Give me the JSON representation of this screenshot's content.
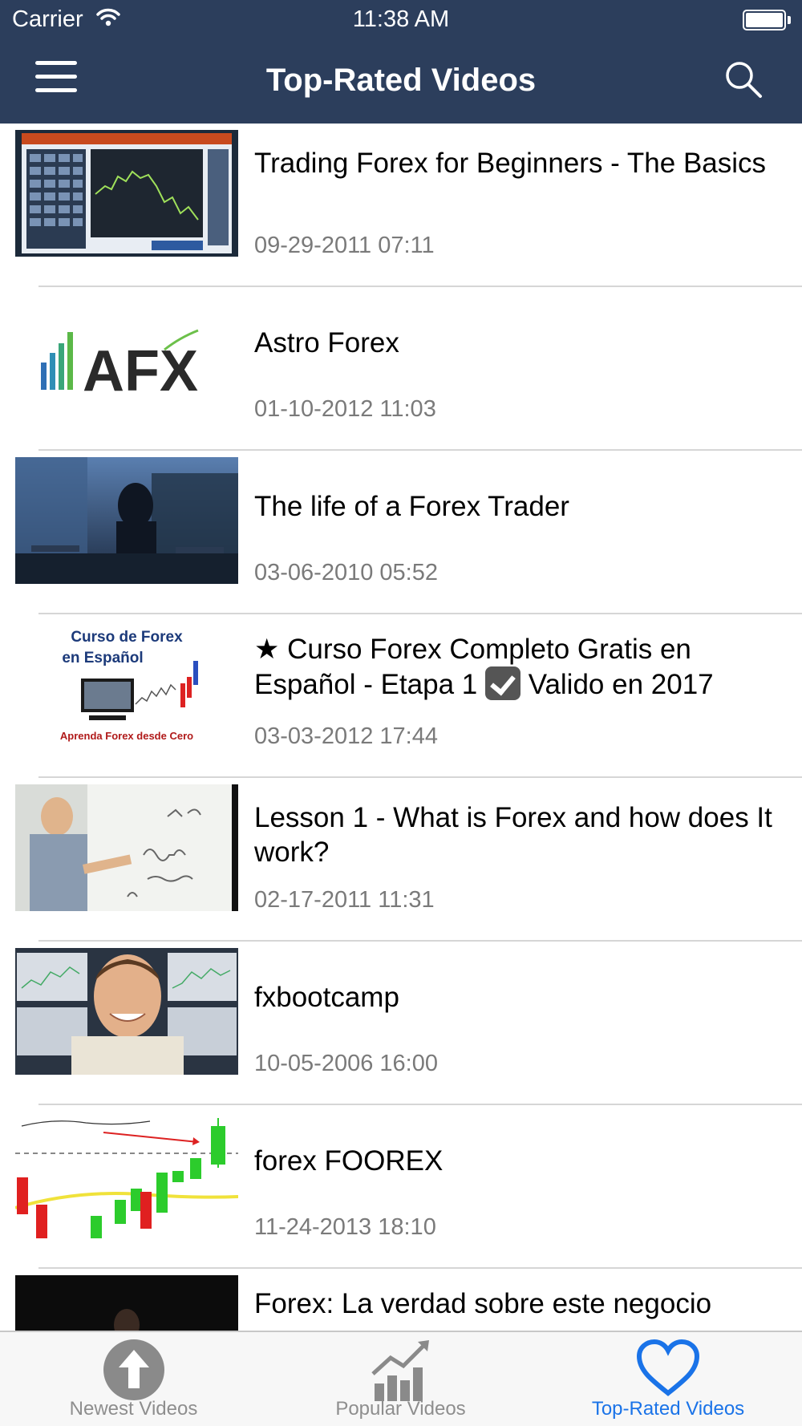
{
  "status_bar": {
    "carrier": "Carrier",
    "time": "11:38 AM"
  },
  "nav": {
    "title": "Top-Rated Videos",
    "menu_icon": "hamburger-menu-icon",
    "search_icon": "search-icon"
  },
  "videos": [
    {
      "title": "Trading Forex for Beginners - The Basics",
      "date": "09-29-2011 07:11"
    },
    {
      "title": "Astro Forex",
      "date": "01-10-2012 11:03"
    },
    {
      "title": "The life of a Forex Trader",
      "date": "03-06-2010 05:52"
    },
    {
      "title_part1": "★ Curso Forex Completo Gratis en Español - Etapa 1 ",
      "title_part2": " Valido en 2017",
      "date": "03-03-2012 17:44",
      "thumb_line1": "Curso de Forex",
      "thumb_line2": "en Español",
      "thumb_caption": "Aprenda Forex desde Cero"
    },
    {
      "title": "Lesson 1 - What is Forex and how does It work?",
      "date": "02-17-2011 11:31"
    },
    {
      "title": "fxbootcamp",
      "date": "10-05-2006 16:00"
    },
    {
      "title": "forex FOOREX",
      "date": "11-24-2013 18:10"
    },
    {
      "title": "Forex: La verdad sobre este negocio",
      "date": ""
    }
  ],
  "afx_logo": {
    "text": "AFX"
  },
  "tabs": [
    {
      "label": "Newest Videos",
      "icon": "up-arrow-circle-icon"
    },
    {
      "label": "Popular Videos",
      "icon": "trending-chart-icon"
    },
    {
      "label": "Top-Rated Videos",
      "icon": "heart-icon"
    }
  ],
  "colors": {
    "header": "#2c3e5c",
    "active_tab": "#1a73e8",
    "inactive_tab": "#8e8e8e",
    "date_text": "#7a7a7a"
  }
}
